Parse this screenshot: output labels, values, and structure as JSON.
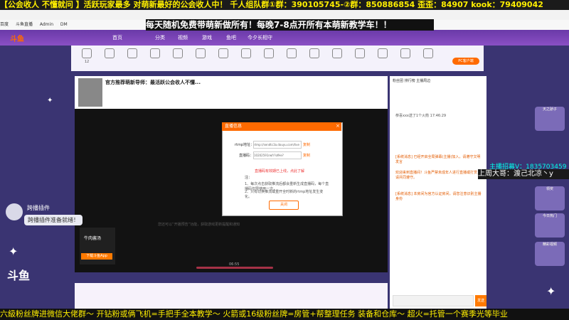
{
  "overlay": {
    "top_banner": "【公会收人 不懂就问 】活跃玩家最多 对萌新最好的公会收人中！ 千人组队群①群：390105745-②群：850886854 歪歪：84907 kook：79409042",
    "top_banner2": "",
    "sub_banner": "每天随机免费带萌新做所有！每晚7-8点开所有本萌新教学车！！",
    "bottom_banner": "六級粉丝牌进微信大佬群～ 开钻粉或俩飞机=手把手全本教学～  火箭或16级粉丝牌=房管+帮整理任务 装备和仓库～  超火=托管一个赛季光等毕业",
    "plugin_name": "跨播插件",
    "plugin_msg": "跨播插件准备就绪！",
    "douyu_logo": "斗鱼",
    "right_tag1": "主播招募V：1835703459",
    "right_tag2": "上周大哥：渡己北凉丶y"
  },
  "nav": {
    "logo": "斗鱼",
    "items": [
      "首页",
      "分类",
      "视频",
      "游戏",
      "鱼吧",
      "今夕长相守"
    ]
  },
  "categories": [
    "12",
    "",
    "",
    "",
    "",
    "",
    "",
    "",
    "",
    "",
    "",
    "",
    "",
    "",
    "",
    "",
    "",
    ""
  ],
  "pc_button": "PC客户端",
  "room": {
    "title": "官方推荐萌新导师：最活跃公会收人不懂...",
    "video_hint": "您还可以“开播预告”功能，获取游戏更新提醒和通知",
    "time": "06:55"
  },
  "dialog": {
    "title": "直播信息",
    "close": "×",
    "rtmp_label": "rtmp地址：",
    "rtmp_value": "rtmp://sendtc3a.douyu.com/live",
    "code_label": "直播码：",
    "code_value": "10202591rwfr?ofHe?xxSecrets=*********",
    "copy": "复制",
    "warning": "直播码有效期已上线，点此了解",
    "note_title": "注：",
    "notes": [
      "1、每次点击获取推流后都会重新生成直播码，每个直播码仅限使用一次，",
      "2、只有切换推流或重开全时新的rtmp地址发生变化。"
    ],
    "close_btn": "关闭"
  },
  "chat": {
    "tabs": "粉丝团  排行榜  主播周边",
    "lines": [
      "[系统消息] 已经开启全局弹幕(主播)加入，请遵守文明发言",
      "欢迎来到直播间！斗鱼严禁未成年人进行直播或打赏，请共同遵守。",
      "[系统消息] 本房间为官方认证房间，请您注意识别主播身份"
    ],
    "send": "发送",
    "gift_user": "恭喜xxx送了1个火箭 17:46:29"
  },
  "anchor": {
    "name": "牛肉酱汤",
    "btn": "下载斗鱼App"
  },
  "sidebar_cards": [
    "天之骄子",
    "领奖",
    "今日热门",
    "精彩视频"
  ]
}
